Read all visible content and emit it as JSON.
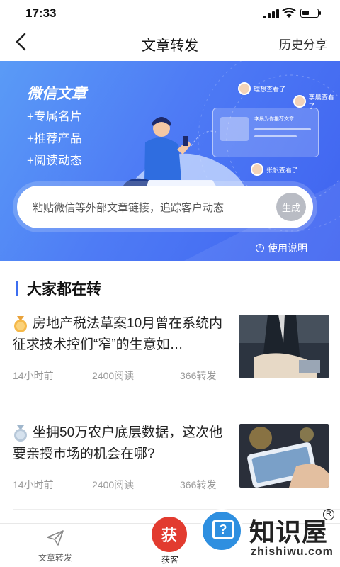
{
  "status_bar": {
    "time": "17:33"
  },
  "nav": {
    "title": "文章转发",
    "history_label": "历史分享"
  },
  "banner": {
    "headline": "微信文章",
    "features": [
      "+专属名片",
      "+推荐产品",
      "+阅读动态"
    ],
    "card_text": "李晨为你推荐文章",
    "viewers": [
      "理想查看了",
      "李晨查看了",
      "张帆查看了"
    ],
    "search_placeholder": "粘贴微信等外部文章链接，追踪客户动态",
    "generate_label": "生成",
    "help_label": "使用说明"
  },
  "section": {
    "title": "大家都在转"
  },
  "articles": [
    {
      "rank": "1",
      "title": "房地产税法草案10月曾在系统内征求技术控们“窄”的生意如…",
      "time": "14小时前",
      "reads": "2400阅读",
      "shares": "366转发"
    },
    {
      "rank": "2",
      "title": "坐拥50万农户底层数据，这次他要亲授市场的机会在哪?",
      "time": "14小时前",
      "reads": "2400阅读",
      "shares": "366转发"
    }
  ],
  "tabbar": {
    "forward_label": "文章转发",
    "center_glyph": "获",
    "center_label": "获客"
  },
  "watermark": {
    "zh": "知识屋",
    "en": "zhishiwu.com",
    "mark": "R"
  },
  "colors": {
    "accent": "#3d6ef0",
    "banner_start": "#5a9bf6",
    "banner_end": "#3f63f0",
    "brand_red": "#e23b2f"
  }
}
